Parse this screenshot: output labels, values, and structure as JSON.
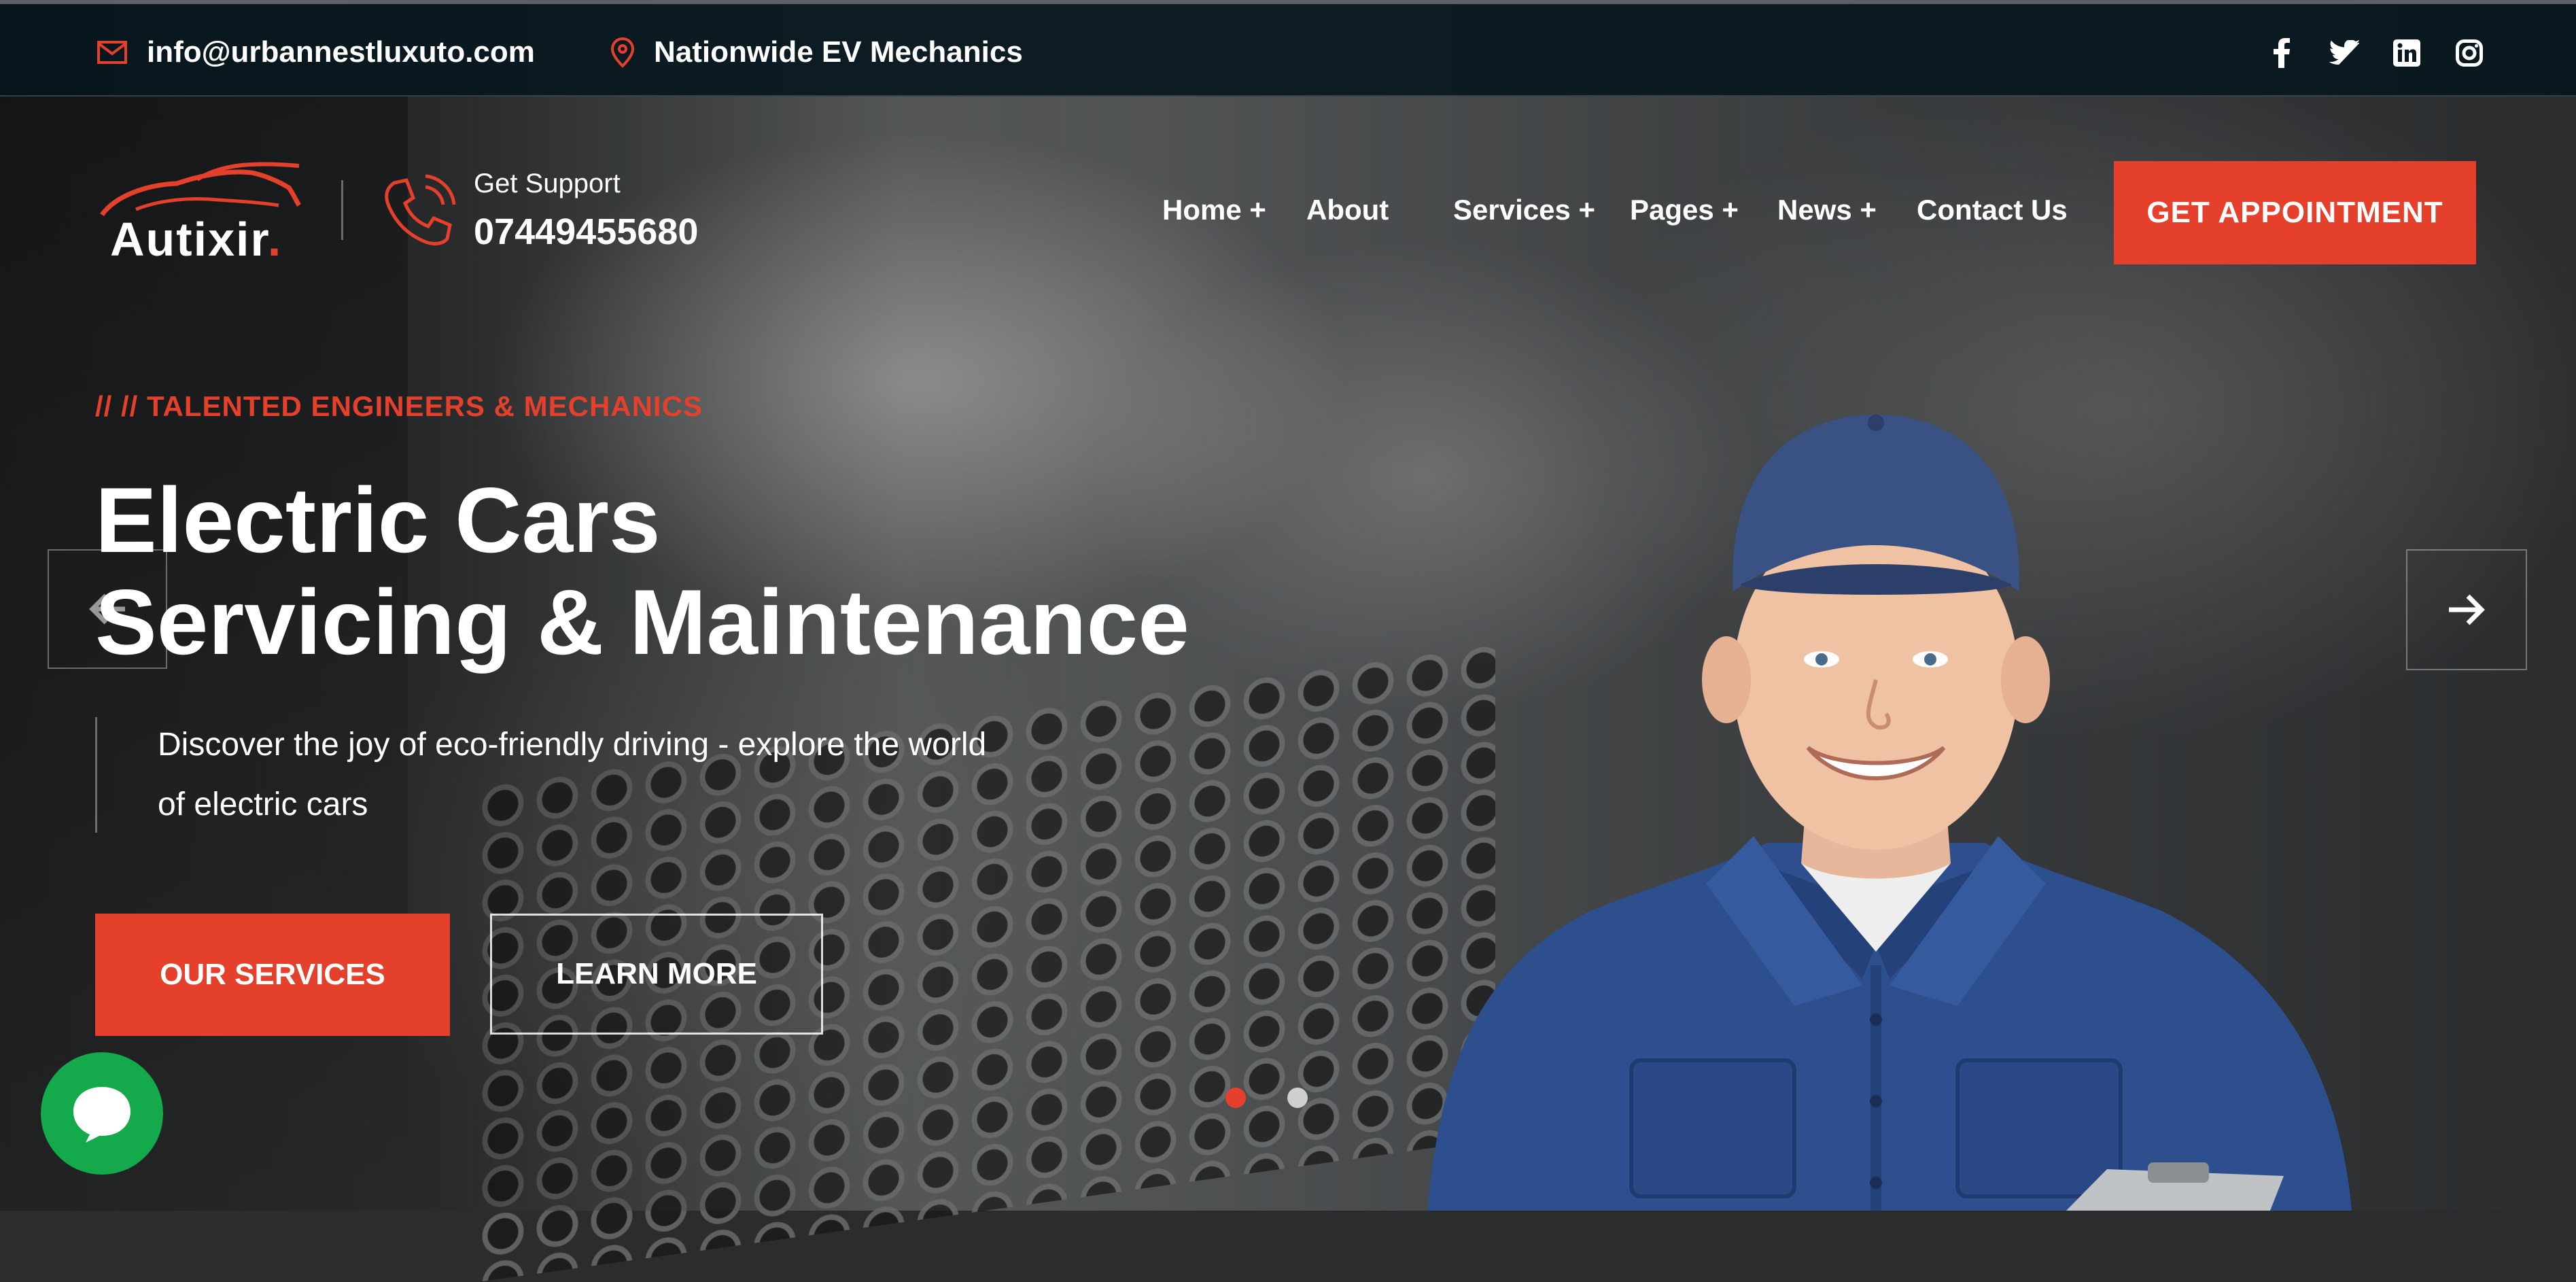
{
  "topbar": {
    "email": "info@urbannestluxuto.com",
    "location": "Nationwide EV Mechanics",
    "socials": [
      "facebook-icon",
      "twitter-icon",
      "linkedin-icon",
      "instagram-icon"
    ]
  },
  "header": {
    "logo_text": "Autixir",
    "logo_dot": ".",
    "support_label": "Get Support",
    "support_phone": "07449455680",
    "nav": [
      "Home +",
      "About",
      "Services +",
      "Pages +",
      "News +",
      "Contact Us"
    ],
    "cta": "GET APPOINTMENT"
  },
  "hero": {
    "kicker": "// // TALENTED ENGINEERS & MECHANICS",
    "title_line1": "Electric Cars",
    "title_line2": "Servicing & Maintenance",
    "description": "Discover the joy of eco-friendly driving - explore the world of electric cars",
    "primary_button": "OUR SERVICES",
    "secondary_button": "LEARN MORE",
    "slides_total": 2,
    "active_slide": 1
  },
  "colors": {
    "accent": "#e5402c",
    "topbar": "#08181e",
    "chat": "#14a94a",
    "uniform": "#2e4f8e"
  }
}
